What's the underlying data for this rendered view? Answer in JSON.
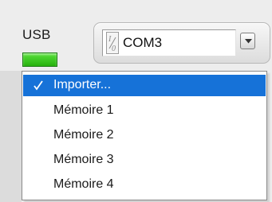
{
  "indicator": {
    "label": "USB",
    "led_color": "#3ccd22",
    "state": "on"
  },
  "combo": {
    "value": "COM3",
    "icon": "io-name-icon",
    "button_icon": "chevron-down-icon"
  },
  "dropdown": {
    "items": [
      {
        "label": "Importer...",
        "selected": true
      },
      {
        "label": "Mémoire 1",
        "selected": false
      },
      {
        "label": "Mémoire 2",
        "selected": false
      },
      {
        "label": "Mémoire 3",
        "selected": false
      },
      {
        "label": "Mémoire 4",
        "selected": false
      }
    ],
    "selection_color": "#1672d8",
    "check_icon": "checkmark-icon"
  }
}
